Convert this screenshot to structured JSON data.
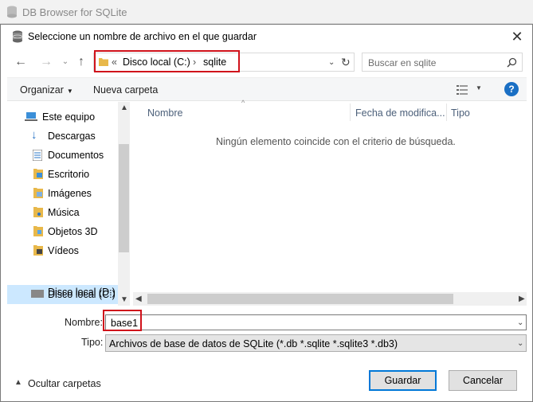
{
  "background_app": {
    "title": "DB Browser for SQLite"
  },
  "dialog": {
    "title": "Seleccione un nombre de archivo en el que guardar",
    "address": {
      "root": "Disco local (C:)",
      "folder": "sqlite",
      "overflow": "«"
    },
    "search_placeholder": "Buscar en sqlite",
    "toolbar": {
      "organize": "Organizar",
      "new_folder": "Nueva carpeta",
      "help": "?"
    },
    "nav": [
      {
        "label": "Este equipo",
        "icon": "computer-icon"
      },
      {
        "label": "Descargas",
        "icon": "download-icon"
      },
      {
        "label": "Documentos",
        "icon": "documents-icon"
      },
      {
        "label": "Escritorio",
        "icon": "desktop-icon"
      },
      {
        "label": "Imágenes",
        "icon": "pictures-icon"
      },
      {
        "label": "Música",
        "icon": "music-icon"
      },
      {
        "label": "Objetos 3D",
        "icon": "objects3d-icon"
      },
      {
        "label": "Vídeos",
        "icon": "videos-icon"
      },
      {
        "label": "Disco local (C:)",
        "icon": "drive-icon",
        "selected": true
      },
      {
        "label": "Disco local (D:)",
        "icon": "drive-icon"
      }
    ],
    "columns": {
      "name": "Nombre",
      "date": "Fecha de modifica...",
      "type": "Tipo"
    },
    "empty_message": "Ningún elemento coincide con el criterio de búsqueda.",
    "filename_label": "Nombre:",
    "filename_value": "base1",
    "filetype_label": "Tipo:",
    "filetype_value": "Archivos de base de datos de SQLite (*.db *.sqlite *.sqlite3 *.db3)",
    "hide_folders": "Ocultar carpetas",
    "save_button": "Guardar",
    "cancel_button": "Cancelar",
    "colors": {
      "highlight": "#d0121b",
      "selected": "#cce8ff",
      "accent": "#0078d7",
      "help": "#1a6fc4"
    }
  }
}
